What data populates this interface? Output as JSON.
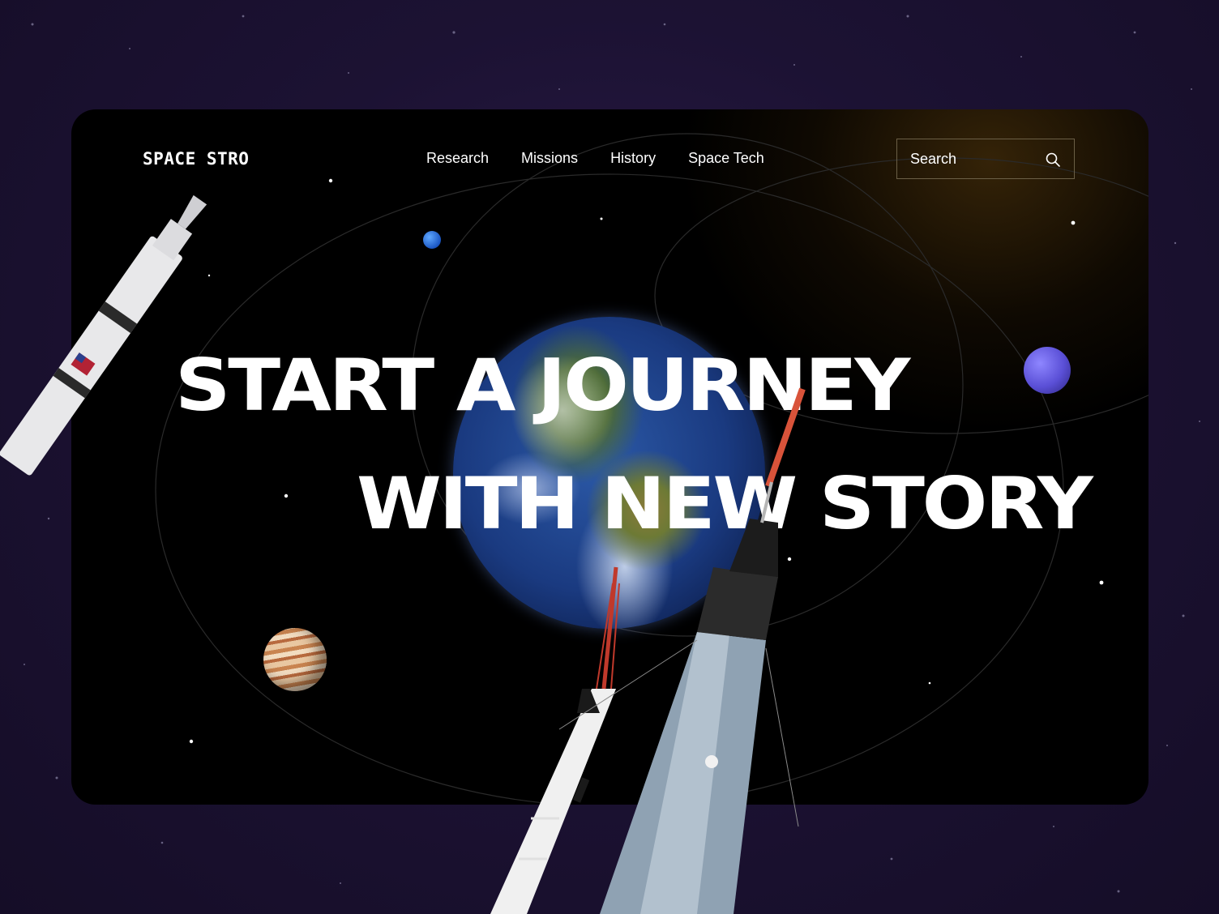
{
  "brand": {
    "name": "SPACE STRO"
  },
  "nav": {
    "items": [
      "Research",
      "Missions",
      "History",
      "Space Tech"
    ]
  },
  "search": {
    "placeholder": "Search",
    "icon": "search-icon"
  },
  "hero": {
    "line1": "START A JOURNEY",
    "line2": "WITH NEW STORY"
  },
  "colors": {
    "background": "#1c1233",
    "card": "#000000",
    "text": "#ffffff",
    "search_border": "#6b5f46"
  }
}
